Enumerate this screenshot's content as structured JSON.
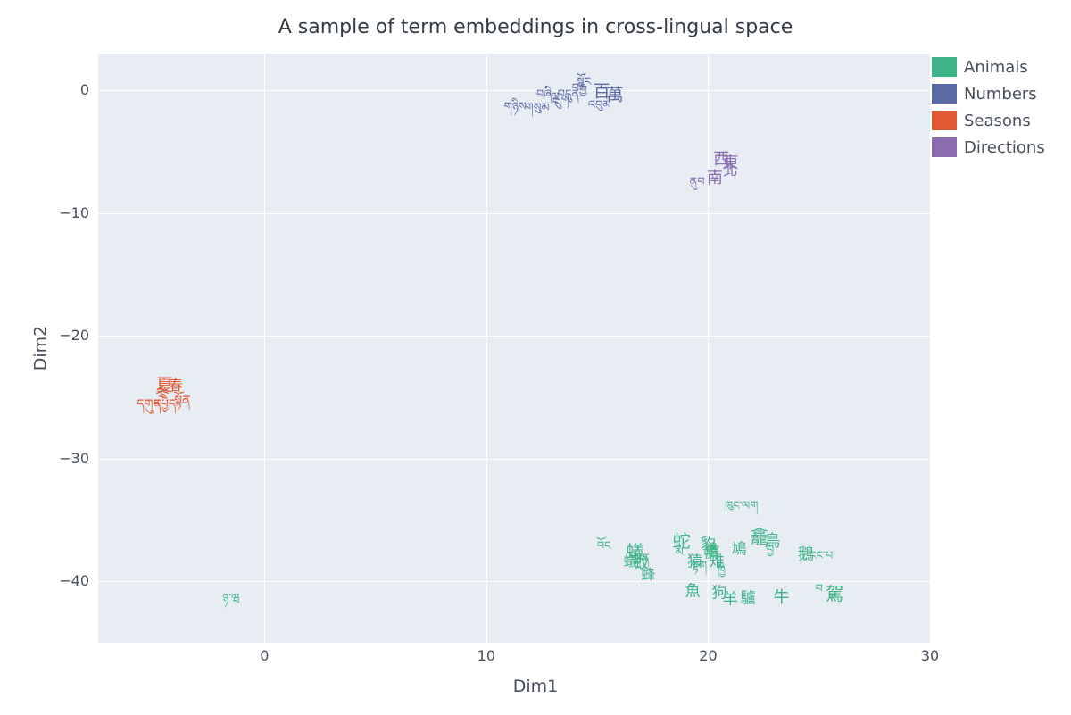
{
  "chart_data": {
    "type": "scatter",
    "title": "A sample of term embeddings in cross-lingual space",
    "xlabel": "Dim1",
    "ylabel": "Dim2",
    "xlim": [
      -7.5,
      30
    ],
    "ylim": [
      -45,
      3
    ],
    "xticks": [
      0,
      10,
      20,
      30
    ],
    "yticks": [
      0,
      -10,
      -20,
      -30,
      -40
    ],
    "grid": true,
    "legend_position": "right",
    "colors": {
      "Animals": "#3eb489",
      "Numbers": "#5a6aa5",
      "Seasons": "#e35933",
      "Directions": "#8b6cb0"
    },
    "series": [
      {
        "name": "Animals",
        "color": "#3eb489",
        "points": [
          {
            "x": -1.5,
            "y": -41.3,
            "label": "ཉ་ཝ",
            "size": 13
          },
          {
            "x": 15.3,
            "y": -37.0,
            "label": "བོང",
            "size": 13
          },
          {
            "x": 16.7,
            "y": -37.5,
            "label": "蟻",
            "size": 20
          },
          {
            "x": 16.5,
            "y": -38.2,
            "label": "蟻",
            "size": 16
          },
          {
            "x": 17.0,
            "y": -38.4,
            "label": "蚊",
            "size": 17
          },
          {
            "x": 17.3,
            "y": -39.3,
            "label": "蜂",
            "size": 16
          },
          {
            "x": 17.0,
            "y": -38.0,
            "label": "སྲན",
            "size": 13
          },
          {
            "x": 18.8,
            "y": -36.6,
            "label": "蛇",
            "size": 20
          },
          {
            "x": 18.7,
            "y": -37.5,
            "label": "མ",
            "size": 13
          },
          {
            "x": 19.4,
            "y": -38.2,
            "label": "猿",
            "size": 17
          },
          {
            "x": 19.6,
            "y": -38.6,
            "label": "སྟག",
            "size": 13
          },
          {
            "x": 19.3,
            "y": -40.6,
            "label": "魚",
            "size": 17
          },
          {
            "x": 20.0,
            "y": -36.8,
            "label": "豹",
            "size": 17
          },
          {
            "x": 20.1,
            "y": -37.3,
            "label": "鴿",
            "size": 17
          },
          {
            "x": 20.2,
            "y": -37.5,
            "label": "鷹",
            "size": 17
          },
          {
            "x": 20.4,
            "y": -38.2,
            "label": "雉",
            "size": 17
          },
          {
            "x": 20.5,
            "y": -40.8,
            "label": "狗",
            "size": 17
          },
          {
            "x": 20.6,
            "y": -39.0,
            "label": "ཁྱི",
            "size": 13
          },
          {
            "x": 21.0,
            "y": -41.3,
            "label": "羊",
            "size": 17
          },
          {
            "x": 21.4,
            "y": -37.2,
            "label": "鳩",
            "size": 17
          },
          {
            "x": 21.5,
            "y": -33.7,
            "label": "ཁུང་ལག",
            "size": 13
          },
          {
            "x": 21.8,
            "y": -41.2,
            "label": "驢",
            "size": 17
          },
          {
            "x": 22.3,
            "y": -36.3,
            "label": "龕",
            "size": 20
          },
          {
            "x": 22.9,
            "y": -36.6,
            "label": "鳥",
            "size": 18
          },
          {
            "x": 22.8,
            "y": -37.3,
            "label": "བྱ",
            "size": 13
          },
          {
            "x": 23.3,
            "y": -41.2,
            "label": "牛",
            "size": 18
          },
          {
            "x": 24.4,
            "y": -37.7,
            "label": "鵝",
            "size": 18
          },
          {
            "x": 25.1,
            "y": -37.8,
            "label": "ངང་པ",
            "size": 13
          },
          {
            "x": 25.0,
            "y": -40.5,
            "label": "བ",
            "size": 13
          },
          {
            "x": 25.7,
            "y": -40.9,
            "label": "駕",
            "size": 20
          },
          {
            "x": 25.6,
            "y": -41.3,
            "label": "ར",
            "size": 13
          }
        ]
      },
      {
        "name": "Numbers",
        "color": "#5a6aa5",
        "points": [
          {
            "x": 11.3,
            "y": -1.2,
            "label": "གཉིས",
            "size": 13
          },
          {
            "x": 12.3,
            "y": -1.3,
            "label": "གསུམ",
            "size": 13
          },
          {
            "x": 12.6,
            "y": -0.2,
            "label": "བཞི",
            "size": 13
          },
          {
            "x": 13.1,
            "y": -0.4,
            "label": "ལྔ",
            "size": 13
          },
          {
            "x": 13.4,
            "y": -0.6,
            "label": "དྲུག",
            "size": 13
          },
          {
            "x": 13.7,
            "y": -0.2,
            "label": "བདུན",
            "size": 13
          },
          {
            "x": 14.2,
            "y": 0.3,
            "label": "བརྒྱ",
            "size": 13
          },
          {
            "x": 14.4,
            "y": 0.8,
            "label": "སྟོང",
            "size": 13
          },
          {
            "x": 15.2,
            "y": 0.0,
            "label": "百",
            "size": 19
          },
          {
            "x": 15.8,
            "y": -0.3,
            "label": "萬",
            "size": 19
          },
          {
            "x": 15.1,
            "y": -1.1,
            "label": "འབུམ",
            "size": 13
          }
        ]
      },
      {
        "name": "Seasons",
        "color": "#e35933",
        "points": [
          {
            "x": -4.5,
            "y": -23.9,
            "label": "夏",
            "size": 19
          },
          {
            "x": -4.0,
            "y": -23.9,
            "label": "春",
            "size": 16
          },
          {
            "x": -4.6,
            "y": -24.5,
            "label": "冬",
            "size": 16
          },
          {
            "x": -5.2,
            "y": -25.5,
            "label": "དགུན",
            "size": 14
          },
          {
            "x": -4.5,
            "y": -25.5,
            "label": "དཔྱིད",
            "size": 14
          },
          {
            "x": -3.7,
            "y": -25.2,
            "label": "སྟོན",
            "size": 14
          }
        ]
      },
      {
        "name": "Directions",
        "color": "#8b6cb0",
        "points": [
          {
            "x": 19.5,
            "y": -7.3,
            "label": "ནུབ",
            "size": 13
          },
          {
            "x": 20.3,
            "y": -7.0,
            "label": "南",
            "size": 18
          },
          {
            "x": 20.6,
            "y": -5.5,
            "label": "西",
            "size": 18
          },
          {
            "x": 21.0,
            "y": -5.8,
            "label": "東",
            "size": 18
          },
          {
            "x": 21.0,
            "y": -6.4,
            "label": "北",
            "size": 16
          }
        ]
      }
    ]
  }
}
